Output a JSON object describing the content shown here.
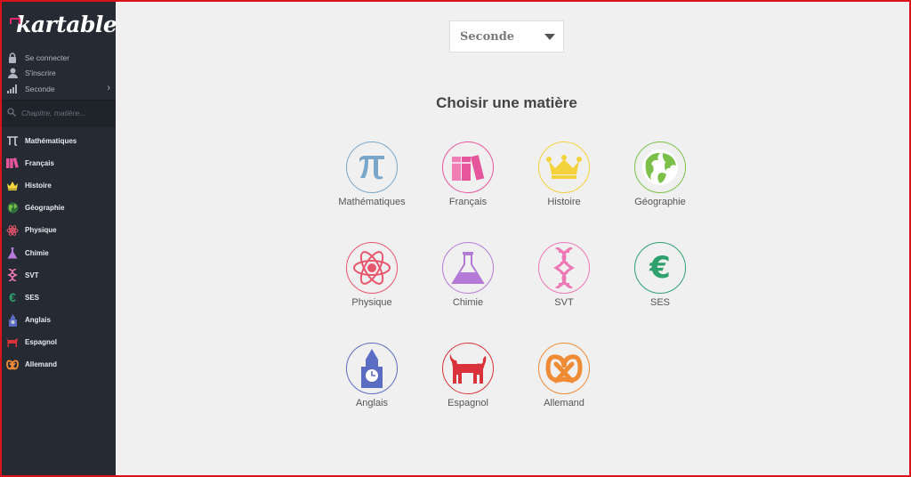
{
  "brand": {
    "name": "kartable"
  },
  "account": {
    "login": "Se connecter",
    "signup": "S'inscrire",
    "level": "Seconde"
  },
  "search": {
    "placeholder": "Chapitre, matière..."
  },
  "subjects": [
    {
      "label": "Mathématiques",
      "icon": "pi-icon",
      "color": "#7aa7c9"
    },
    {
      "label": "Français",
      "icon": "books-icon",
      "color": "#e6569c"
    },
    {
      "label": "Histoire",
      "icon": "crown-icon",
      "color": "#f4d23c"
    },
    {
      "label": "Géographie",
      "icon": "globe-icon",
      "color": "#7cc04a"
    },
    {
      "label": "Physique",
      "icon": "atom-icon",
      "color": "#e8566e"
    },
    {
      "label": "Chimie",
      "icon": "flask-icon",
      "color": "#b47ad8"
    },
    {
      "label": "SVT",
      "icon": "dna-icon",
      "color": "#ee78b6"
    },
    {
      "label": "SES",
      "icon": "euro-icon",
      "color": "#2ea06e"
    },
    {
      "label": "Anglais",
      "icon": "big-ben-icon",
      "color": "#5b6cc3"
    },
    {
      "label": "Espagnol",
      "icon": "bull-icon",
      "color": "#d9323a"
    },
    {
      "label": "Allemand",
      "icon": "pretzel-icon",
      "color": "#ef8b35"
    }
  ],
  "main": {
    "level_select": "Seconde",
    "heading": "Choisir une matière"
  }
}
